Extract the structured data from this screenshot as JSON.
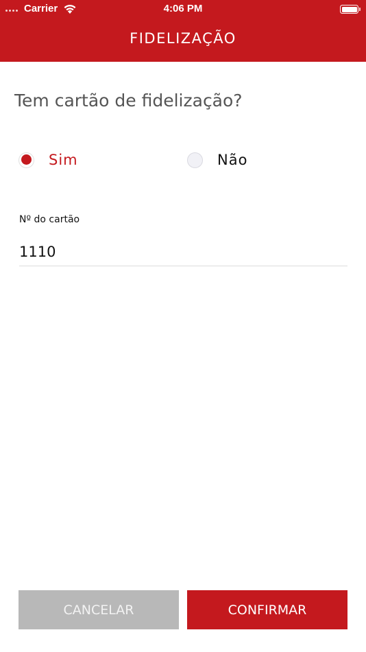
{
  "status_bar": {
    "carrier": "Carrier",
    "time": "4:06 PM",
    "icons": [
      "signal-dots-icon",
      "wifi-icon",
      "battery-icon"
    ]
  },
  "header": {
    "title": "FIDELIZAÇÃO"
  },
  "form": {
    "question": "Tem cartão de fidelização?",
    "options": [
      {
        "label": "Sim",
        "selected": true
      },
      {
        "label": "Não",
        "selected": false
      }
    ],
    "card_number_label": "Nº do cartão",
    "card_number_value": "1110"
  },
  "actions": {
    "cancel_label": "CANCELAR",
    "confirm_label": "CONFIRMAR"
  },
  "colors": {
    "brand": "#c4191e",
    "cancel_bg": "#b8b8b8",
    "text": "#111111",
    "question_text": "#555555"
  }
}
